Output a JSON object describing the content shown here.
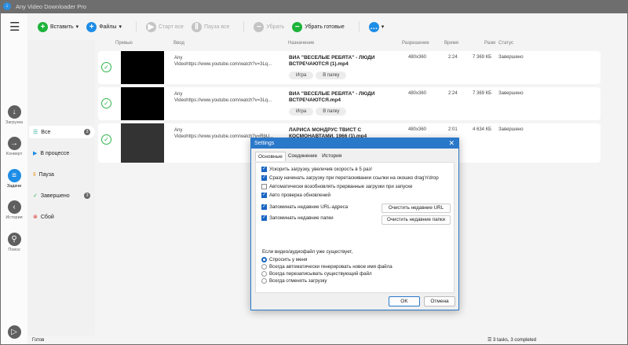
{
  "title": "Any Video Downloader Pro",
  "toolbar": {
    "paste": "Вставить",
    "files": "Файлы",
    "start_all": "Старт все",
    "pause_all": "Пауза все",
    "remove": "Убрать",
    "remove_done": "Убрать готовые"
  },
  "nav": [
    {
      "label": "Загрузка"
    },
    {
      "label": "Конверт"
    },
    {
      "label": "Задачи"
    },
    {
      "label": "История"
    },
    {
      "label": "Поиск"
    }
  ],
  "filters": [
    {
      "label": "Все",
      "count": "3"
    },
    {
      "label": "В процессе"
    },
    {
      "label": "Пауза"
    },
    {
      "label": "Завершено",
      "count": "3"
    },
    {
      "label": "Сбой"
    }
  ],
  "columns": {
    "preview": "Превью",
    "input": "Ввод",
    "dest": "Назначение",
    "res": "Разрешение",
    "time": "Время",
    "size": "Разм",
    "status": "Статус"
  },
  "rows": [
    {
      "src1": "Any",
      "src2": "Videohttps://www.youtube.com/watch?v=3Lq...",
      "dest": "ВИА \"ВЕСЕЛЫЕ РЕБЯТА\" - ЛЮДИ ВСТРЕЧАЮТСЯ (1).mp4",
      "res": "480x360",
      "time": "2:24",
      "size": "7 369 КБ",
      "status": "Завершено",
      "play": "Игра",
      "folder": "В папку"
    },
    {
      "src1": "Any",
      "src2": "Videohttps://www.youtube.com/watch?v=3Lq...",
      "dest": "ВИА \"ВЕСЕЛЫЕ РЕБЯТА\" - ЛЮДИ ВСТРЕЧАЮТСЯ.mp4",
      "res": "480x360",
      "time": "2:24",
      "size": "7 369 КБ",
      "status": "Завершено",
      "play": "Игра",
      "folder": "В папку"
    },
    {
      "src1": "Any",
      "src2": "Videohttps://www.youtube.com/watch?v=RbU...",
      "dest": "ЛАРИСА МОНДРУС  ТВИСТ С КОСМОНАВТАМИ, 1966 (1).mp4",
      "res": "480x360",
      "time": "2:01",
      "size": "4 634 КБ",
      "status": "Завершено"
    }
  ],
  "status": {
    "left": "Готов",
    "right": "3 tasks, 3 completed"
  },
  "dialog": {
    "title": "Settings",
    "tabs": [
      "Основные",
      "Соединение",
      "История"
    ],
    "checks": [
      {
        "label": "Ускорить загрузку, увеличив скорость в 5 раз!",
        "checked": true
      },
      {
        "label": "Сразу начинать загрузку при перетаскивании ссылки на окошко drag'n'drop",
        "checked": true
      },
      {
        "label": "Автоматически возобновлять прерванные загрузки при запуске",
        "checked": false
      },
      {
        "label": "Авто проверка обновлений",
        "checked": true
      },
      {
        "label": "Запоминать недавние URL-адреса",
        "checked": true
      },
      {
        "label": "Запоминать недавние папки",
        "checked": true
      }
    ],
    "clear_urls": "Очистить недавние URL",
    "clear_folders": "Очистить недавние папки",
    "exists_label": "Если видео/аудиофайл уже существует,",
    "radios": [
      "Спросить у меня",
      "Всегда автоматически генерировать новое имя файла",
      "Всегда перезаписывать существующий файл",
      "Всегда отменять загрузку"
    ],
    "ok": "OK",
    "cancel": "Отмена"
  }
}
